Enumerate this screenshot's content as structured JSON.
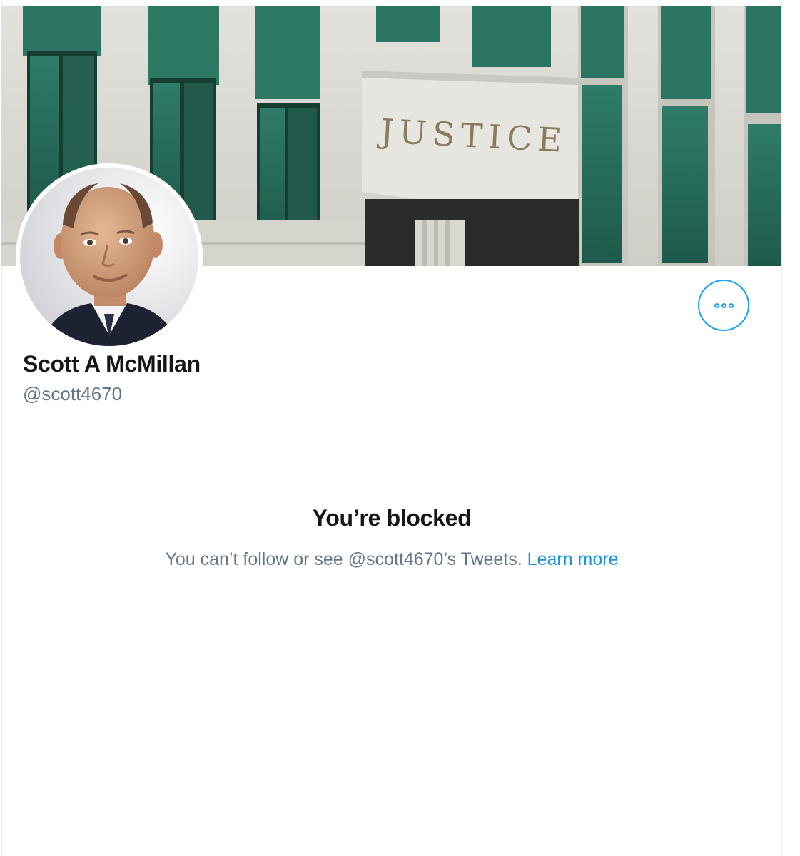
{
  "profile": {
    "banner": {
      "description": "banner-image",
      "engraved_text": "JUSTICE"
    },
    "avatar": {
      "description": "avatar-image"
    },
    "more_button": {
      "icon": "more-horizontal-icon"
    },
    "display_name": "Scott A McMillan",
    "handle": "@scott4670"
  },
  "blocked_notice": {
    "title": "You’re blocked",
    "message": "You can’t follow or see @scott4670’s Tweets.",
    "link_label": "Learn more"
  },
  "colors": {
    "accent": "#1da1f2",
    "link": "#1b95e0",
    "primary_text": "#14171a",
    "secondary_text": "#657786",
    "border": "#e6ecf0"
  }
}
